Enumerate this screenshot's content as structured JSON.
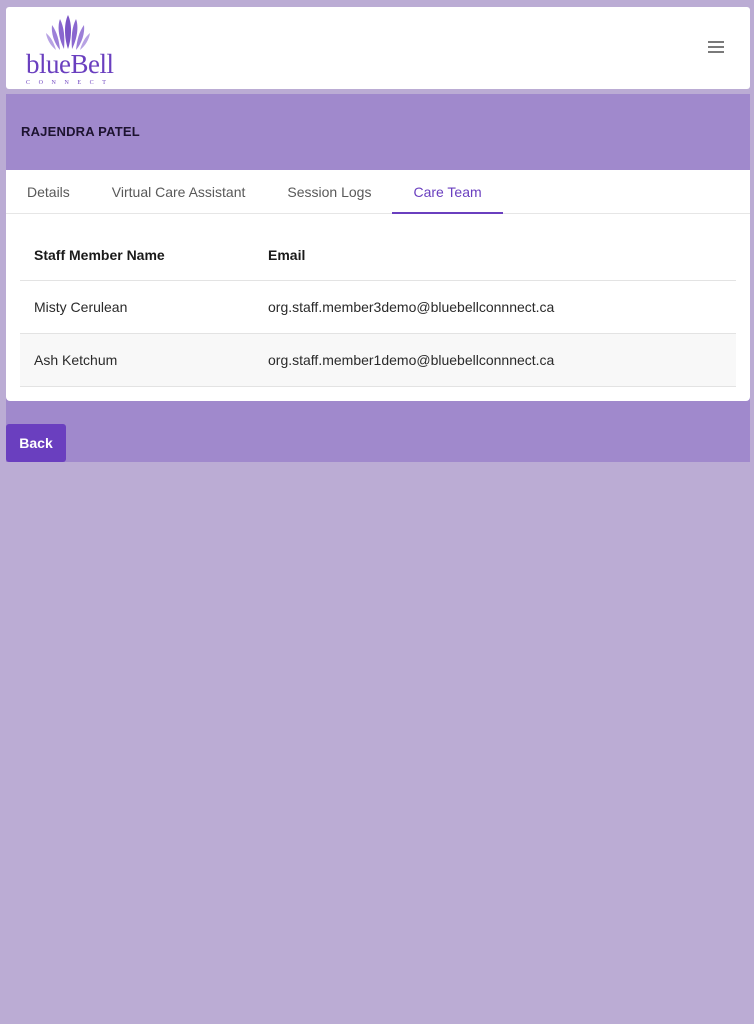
{
  "app": {
    "logo_text": "blueBell",
    "logo_subtext": "CONNECT",
    "menu_icon": "hamburger-icon"
  },
  "patient": {
    "name": "RAJENDRA PATEL"
  },
  "tabs": [
    {
      "label": "Details",
      "active": false
    },
    {
      "label": "Virtual Care Assistant",
      "active": false
    },
    {
      "label": "Session Logs",
      "active": false
    },
    {
      "label": "Care Team",
      "active": true
    }
  ],
  "care_team": {
    "columns": [
      "Staff Member Name",
      "Email"
    ],
    "rows": [
      {
        "name": "Misty Cerulean",
        "email": "org.staff.member3demo@bluebellconnnect.ca"
      },
      {
        "name": "Ash Ketchum",
        "email": "org.staff.member1demo@bluebellconnnect.ca"
      }
    ]
  },
  "actions": {
    "back_label": "Back"
  },
  "colors": {
    "accent": "#6a3fbf",
    "band": "#a089cc",
    "background": "#bbacd4"
  }
}
